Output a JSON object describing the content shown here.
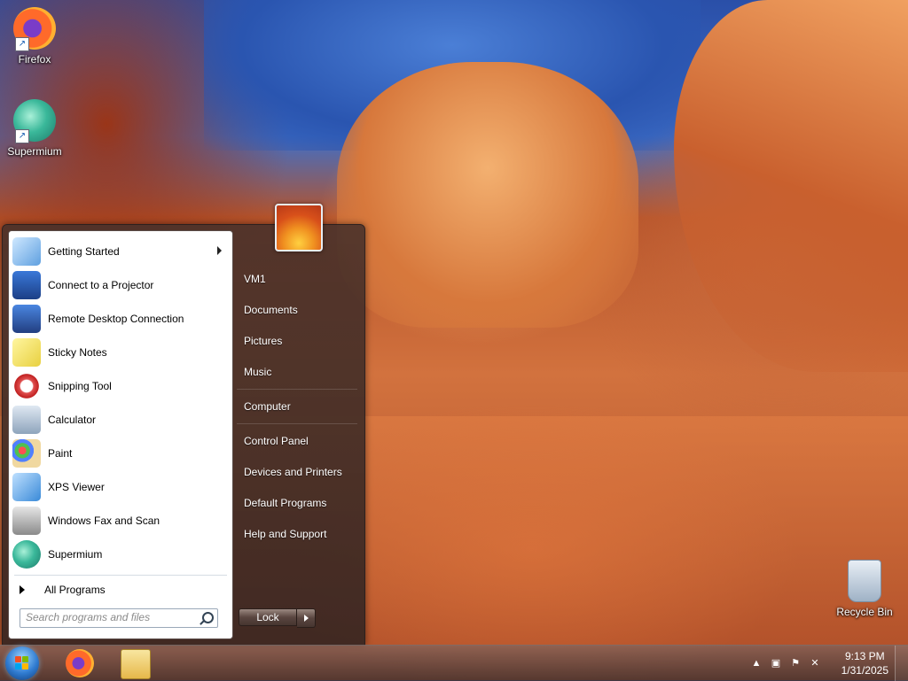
{
  "desktop": {
    "icons": [
      {
        "label": "Firefox",
        "icon": "firefox-icon"
      },
      {
        "label": "Supermium",
        "icon": "supermium-icon"
      },
      {
        "label": "Recycle Bin",
        "icon": "recycle-bin-icon"
      }
    ]
  },
  "start_menu": {
    "programs": [
      {
        "label": "Getting Started",
        "icon": "getting-started-icon",
        "has_submenu": true
      },
      {
        "label": "Connect to a Projector",
        "icon": "projector-icon"
      },
      {
        "label": "Remote Desktop Connection",
        "icon": "remote-desktop-icon"
      },
      {
        "label": "Sticky Notes",
        "icon": "sticky-notes-icon"
      },
      {
        "label": "Snipping Tool",
        "icon": "snipping-tool-icon"
      },
      {
        "label": "Calculator",
        "icon": "calculator-icon"
      },
      {
        "label": "Paint",
        "icon": "paint-icon"
      },
      {
        "label": "XPS Viewer",
        "icon": "xps-viewer-icon"
      },
      {
        "label": "Windows Fax and Scan",
        "icon": "fax-scan-icon"
      },
      {
        "label": "Supermium",
        "icon": "supermium-icon"
      }
    ],
    "all_programs_label": "All Programs",
    "search_placeholder": "Search programs and files",
    "right_items": [
      {
        "label": "VM1"
      },
      {
        "label": "Documents"
      },
      {
        "label": "Pictures"
      },
      {
        "label": "Music"
      },
      {
        "label": "Computer"
      },
      {
        "label": "Control Panel"
      },
      {
        "label": "Devices and Printers"
      },
      {
        "label": "Default Programs"
      },
      {
        "label": "Help and Support"
      }
    ],
    "lock_label": "Lock"
  },
  "taskbar": {
    "pinned": [
      "start-orb-icon",
      "firefox-icon",
      "file-explorer-icon"
    ],
    "tray_icons": [
      "show-hidden-icons-icon",
      "network-icon",
      "action-center-flag-icon",
      "volume-muted-icon"
    ],
    "time": "9:13 PM",
    "date": "1/31/2025"
  },
  "colors": {
    "start_menu_bg": "#46302a",
    "left_pane_bg": "#ffffff",
    "taskbar_bg": "#5a4440"
  }
}
